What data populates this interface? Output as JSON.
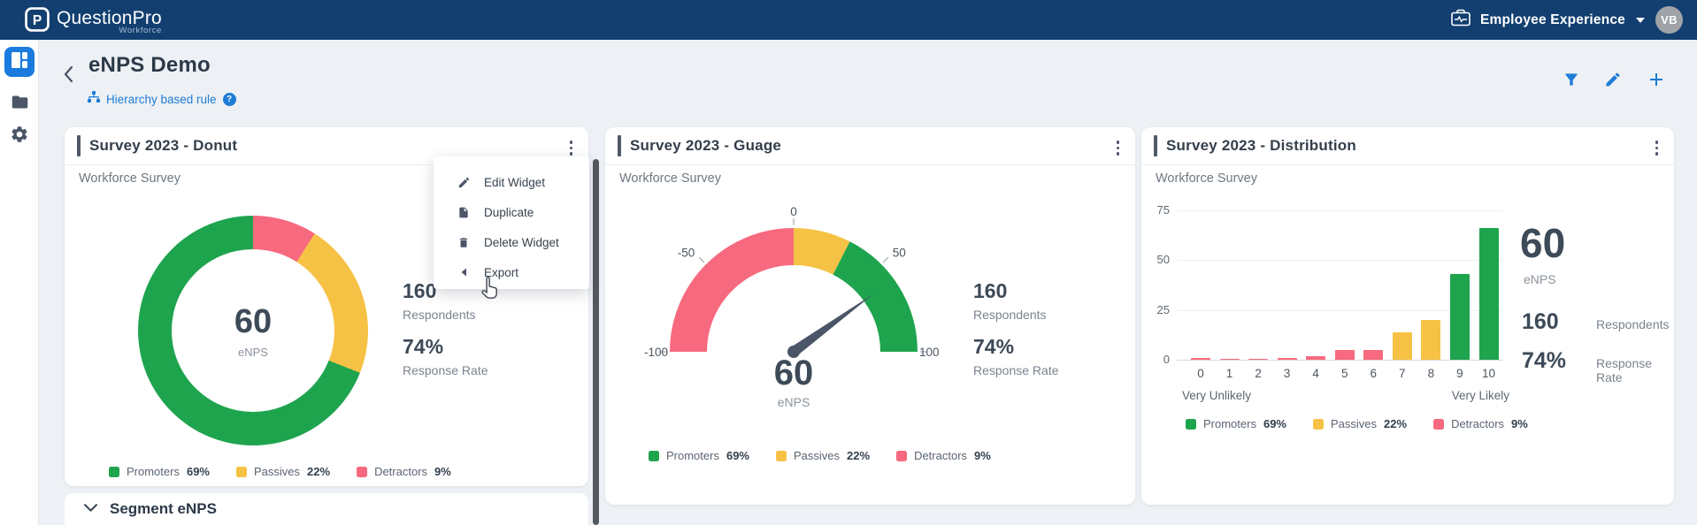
{
  "topbar": {
    "brand": "QuestionPro",
    "brand_sub": "Workforce",
    "workspace_label": "Employee Experience",
    "avatar_initials": "VB"
  },
  "header": {
    "title": "eNPS Demo",
    "rule_label": "Hierarchy based rule"
  },
  "section": {
    "title": "Segment eNPS"
  },
  "context_menu": {
    "items": [
      {
        "icon": "pencil-icon",
        "label": "Edit Widget"
      },
      {
        "icon": "duplicate-icon",
        "label": "Duplicate"
      },
      {
        "icon": "trash-icon",
        "label": "Delete Widget"
      },
      {
        "icon": "submenu-left-icon",
        "label": "Export"
      }
    ]
  },
  "widgets": {
    "donut": {
      "title": "Survey 2023 - Donut",
      "subtitle": "Workforce Survey",
      "enps_value": "60",
      "enps_label": "eNPS",
      "respondents_value": "160",
      "respondents_label": "Respondents",
      "response_rate_value": "74%",
      "response_rate_label": "Response Rate"
    },
    "gauge": {
      "title": "Survey 2023 - Guage",
      "subtitle": "Workforce Survey",
      "enps_value": "60",
      "enps_label": "eNPS",
      "respondents_value": "160",
      "respondents_label": "Respondents",
      "response_rate_value": "74%",
      "response_rate_label": "Response Rate"
    },
    "distribution": {
      "title": "Survey 2023 - Distribution",
      "subtitle": "Workforce Survey",
      "enps_value": "60",
      "enps_label": "eNPS",
      "respondents_value": "160",
      "respondents_label": "Respondents",
      "response_rate_value": "74%",
      "response_rate_label": "Response Rate"
    }
  },
  "legend": [
    {
      "label": "Promoters",
      "value": "69%",
      "color": "#1FA44E"
    },
    {
      "label": "Passives",
      "value": "22%",
      "color": "#F6C245"
    },
    {
      "label": "Detractors",
      "value": "9%",
      "color": "#F7697E"
    }
  ],
  "colors": {
    "promoter": "#1FA44E",
    "passive": "#F6C245",
    "detractor": "#F7697E",
    "accent_blue": "#1E7CD7",
    "topbar_navy": "#123F70"
  },
  "chart_data": [
    {
      "type": "pie",
      "title": "Survey 2023 - Donut",
      "center_value": 60,
      "center_label": "eNPS",
      "start_angle_deg": 0,
      "direction": "clockwise",
      "slices": [
        {
          "label": "Detractors",
          "pct": 9,
          "color": "#F7697E"
        },
        {
          "label": "Passives",
          "pct": 22,
          "color": "#F6C245"
        },
        {
          "label": "Promoters",
          "pct": 69,
          "color": "#1FA44E"
        }
      ]
    },
    {
      "type": "gauge",
      "title": "Survey 2023 - Guage",
      "min": -100,
      "max": 100,
      "value": 60,
      "ticks": [
        -100,
        -50,
        0,
        50,
        100
      ],
      "segments": [
        {
          "from": -100,
          "to": 0,
          "color": "#F7697E",
          "label": "Detractors"
        },
        {
          "from": 0,
          "to": 30,
          "color": "#F6C245",
          "label": "Passives"
        },
        {
          "from": 30,
          "to": 100,
          "color": "#1FA44E",
          "label": "Promoters"
        }
      ]
    },
    {
      "type": "bar",
      "title": "Survey 2023 - Distribution",
      "categories": [
        "0",
        "1",
        "2",
        "3",
        "4",
        "5",
        "6",
        "7",
        "8",
        "9",
        "10"
      ],
      "values": [
        1,
        0,
        0,
        1,
        2,
        5,
        5,
        14,
        20,
        43,
        66
      ],
      "bar_colors": [
        "#F7697E",
        "#F7697E",
        "#F7697E",
        "#F7697E",
        "#F7697E",
        "#F7697E",
        "#F7697E",
        "#F6C245",
        "#F6C245",
        "#1FA44E",
        "#1FA44E"
      ],
      "ylabel_ticks": [
        0,
        25,
        50,
        75
      ],
      "ylim": [
        0,
        75
      ],
      "xlabel_left": "Very Unlikely",
      "xlabel_right": "Very Likely",
      "grid": true
    }
  ]
}
